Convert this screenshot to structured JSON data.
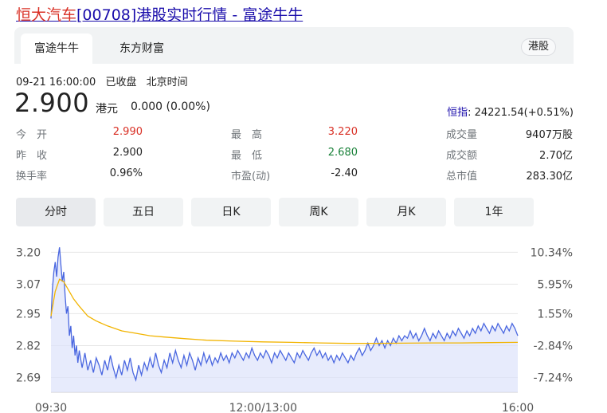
{
  "header": {
    "title_highlight": "恒大汽车",
    "title_rest": "[00708]港股实时行情 - 富途牛牛"
  },
  "source_tabs": [
    {
      "label": "富途牛牛",
      "active": true
    },
    {
      "label": "东方财富",
      "active": false
    }
  ],
  "market_chip": "港股",
  "meta": {
    "datetime": "09-21 16:00:00",
    "status": "已收盘",
    "timezone": "北京时间"
  },
  "quote": {
    "price": "2.900",
    "currency": "港元",
    "change": "0.000 (0.00%)",
    "index_name": "恒指",
    "index_value": ": 24221.54(+0.51%)"
  },
  "stats": [
    [
      {
        "label": "今　开",
        "value": "2.990",
        "tone": "up"
      },
      {
        "label": "最　高",
        "value": "3.220",
        "tone": "up"
      },
      {
        "label": "成交量",
        "value": "9407万股",
        "tone": ""
      }
    ],
    [
      {
        "label": "昨　收",
        "value": "2.900",
        "tone": ""
      },
      {
        "label": "最　低",
        "value": "2.680",
        "tone": "down"
      },
      {
        "label": "成交额",
        "value": "2.70亿",
        "tone": ""
      }
    ],
    [
      {
        "label": "换手率",
        "value": "0.96%",
        "tone": ""
      },
      {
        "label": "市盈(动)",
        "value": "-2.40",
        "tone": ""
      },
      {
        "label": "总市值",
        "value": "283.30亿",
        "tone": ""
      }
    ]
  ],
  "range_tabs": [
    {
      "label": "分时",
      "active": true
    },
    {
      "label": "五日",
      "active": false
    },
    {
      "label": "日K",
      "active": false
    },
    {
      "label": "周K",
      "active": false
    },
    {
      "label": "月K",
      "active": false
    },
    {
      "label": "1年",
      "active": false
    }
  ],
  "colors": {
    "price_line": "#4a67e0",
    "avg_line": "#f2b400",
    "fill": "#dde3fb",
    "grid": "#e6e6e6"
  },
  "chart_data": {
    "type": "line",
    "ylim": [
      2.63,
      3.24
    ],
    "y_ticks": [
      {
        "value": 3.2,
        "label": "3.20",
        "pct": "10.34%"
      },
      {
        "value": 3.07,
        "label": "3.07",
        "pct": "5.95%"
      },
      {
        "value": 2.95,
        "label": "2.95",
        "pct": "1.55%"
      },
      {
        "value": 2.82,
        "label": "2.82",
        "pct": "-2.84%"
      },
      {
        "value": 2.69,
        "label": "2.69",
        "pct": "-7.24%"
      }
    ],
    "x_ticks": [
      {
        "t": 0,
        "label": "09:30"
      },
      {
        "t": 150,
        "label": "12:00/13:00"
      },
      {
        "t": 330,
        "label": "16:00"
      }
    ],
    "t_max": 330,
    "series": [
      {
        "key": "price",
        "values": [
          [
            0,
            2.93
          ],
          [
            1,
            3.05
          ],
          [
            2,
            3.12
          ],
          [
            3,
            3.16
          ],
          [
            4,
            3.1
          ],
          [
            5,
            3.18
          ],
          [
            6,
            3.22
          ],
          [
            7,
            3.15
          ],
          [
            8,
            3.08
          ],
          [
            9,
            3.12
          ],
          [
            10,
            3.02
          ],
          [
            11,
            2.95
          ],
          [
            12,
            2.98
          ],
          [
            13,
            2.86
          ],
          [
            14,
            2.9
          ],
          [
            15,
            2.81
          ],
          [
            16,
            2.86
          ],
          [
            17,
            2.78
          ],
          [
            18,
            2.82
          ],
          [
            19,
            2.75
          ],
          [
            20,
            2.8
          ],
          [
            22,
            2.73
          ],
          [
            24,
            2.79
          ],
          [
            26,
            2.72
          ],
          [
            28,
            2.76
          ],
          [
            30,
            2.71
          ],
          [
            32,
            2.77
          ],
          [
            34,
            2.74
          ],
          [
            36,
            2.7
          ],
          [
            38,
            2.76
          ],
          [
            40,
            2.72
          ],
          [
            42,
            2.78
          ],
          [
            44,
            2.73
          ],
          [
            46,
            2.69
          ],
          [
            48,
            2.74
          ],
          [
            50,
            2.7
          ],
          [
            52,
            2.76
          ],
          [
            54,
            2.72
          ],
          [
            56,
            2.77
          ],
          [
            58,
            2.71
          ],
          [
            60,
            2.68
          ],
          [
            62,
            2.74
          ],
          [
            64,
            2.7
          ],
          [
            66,
            2.75
          ],
          [
            68,
            2.72
          ],
          [
            70,
            2.77
          ],
          [
            72,
            2.73
          ],
          [
            74,
            2.79
          ],
          [
            76,
            2.74
          ],
          [
            78,
            2.71
          ],
          [
            80,
            2.76
          ],
          [
            82,
            2.73
          ],
          [
            84,
            2.79
          ],
          [
            86,
            2.75
          ],
          [
            88,
            2.8
          ],
          [
            90,
            2.76
          ],
          [
            92,
            2.73
          ],
          [
            94,
            2.78
          ],
          [
            96,
            2.74
          ],
          [
            98,
            2.79
          ],
          [
            100,
            2.76
          ],
          [
            102,
            2.72
          ],
          [
            104,
            2.77
          ],
          [
            106,
            2.74
          ],
          [
            108,
            2.79
          ],
          [
            110,
            2.75
          ],
          [
            112,
            2.78
          ],
          [
            114,
            2.74
          ],
          [
            116,
            2.77
          ],
          [
            118,
            2.75
          ],
          [
            120,
            2.79
          ],
          [
            122,
            2.76
          ],
          [
            124,
            2.78
          ],
          [
            126,
            2.75
          ],
          [
            128,
            2.79
          ],
          [
            130,
            2.77
          ],
          [
            132,
            2.8
          ],
          [
            134,
            2.78
          ],
          [
            136,
            2.76
          ],
          [
            138,
            2.79
          ],
          [
            140,
            2.77
          ],
          [
            142,
            2.81
          ],
          [
            144,
            2.78
          ],
          [
            146,
            2.76
          ],
          [
            148,
            2.79
          ],
          [
            150,
            2.77
          ],
          [
            152,
            2.8
          ],
          [
            154,
            2.78
          ],
          [
            156,
            2.75
          ],
          [
            158,
            2.79
          ],
          [
            160,
            2.77
          ],
          [
            162,
            2.8
          ],
          [
            164,
            2.78
          ],
          [
            166,
            2.76
          ],
          [
            168,
            2.79
          ],
          [
            170,
            2.77
          ],
          [
            172,
            2.75
          ],
          [
            174,
            2.79
          ],
          [
            176,
            2.77
          ],
          [
            178,
            2.8
          ],
          [
            180,
            2.78
          ],
          [
            182,
            2.76
          ],
          [
            184,
            2.79
          ],
          [
            186,
            2.81
          ],
          [
            188,
            2.78
          ],
          [
            190,
            2.8
          ],
          [
            192,
            2.77
          ],
          [
            194,
            2.79
          ],
          [
            196,
            2.76
          ],
          [
            198,
            2.78
          ],
          [
            200,
            2.75
          ],
          [
            202,
            2.78
          ],
          [
            204,
            2.76
          ],
          [
            206,
            2.79
          ],
          [
            208,
            2.77
          ],
          [
            210,
            2.75
          ],
          [
            212,
            2.78
          ],
          [
            214,
            2.76
          ],
          [
            216,
            2.79
          ],
          [
            218,
            2.81
          ],
          [
            220,
            2.78
          ],
          [
            222,
            2.8
          ],
          [
            224,
            2.83
          ],
          [
            226,
            2.8
          ],
          [
            228,
            2.82
          ],
          [
            230,
            2.85
          ],
          [
            232,
            2.82
          ],
          [
            234,
            2.84
          ],
          [
            236,
            2.81
          ],
          [
            238,
            2.84
          ],
          [
            240,
            2.82
          ],
          [
            242,
            2.85
          ],
          [
            244,
            2.83
          ],
          [
            246,
            2.86
          ],
          [
            248,
            2.84
          ],
          [
            250,
            2.86
          ],
          [
            252,
            2.85
          ],
          [
            254,
            2.88
          ],
          [
            256,
            2.85
          ],
          [
            258,
            2.87
          ],
          [
            260,
            2.84
          ],
          [
            262,
            2.86
          ],
          [
            264,
            2.89
          ],
          [
            266,
            2.86
          ],
          [
            268,
            2.84
          ],
          [
            270,
            2.87
          ],
          [
            272,
            2.85
          ],
          [
            274,
            2.88
          ],
          [
            276,
            2.86
          ],
          [
            278,
            2.84
          ],
          [
            280,
            2.87
          ],
          [
            282,
            2.85
          ],
          [
            284,
            2.88
          ],
          [
            286,
            2.86
          ],
          [
            288,
            2.89
          ],
          [
            290,
            2.87
          ],
          [
            292,
            2.85
          ],
          [
            294,
            2.88
          ],
          [
            296,
            2.86
          ],
          [
            298,
            2.89
          ],
          [
            300,
            2.87
          ],
          [
            302,
            2.9
          ],
          [
            304,
            2.88
          ],
          [
            306,
            2.91
          ],
          [
            308,
            2.89
          ],
          [
            310,
            2.87
          ],
          [
            312,
            2.9
          ],
          [
            314,
            2.88
          ],
          [
            316,
            2.91
          ],
          [
            318,
            2.89
          ],
          [
            320,
            2.87
          ],
          [
            322,
            2.9
          ],
          [
            324,
            2.88
          ],
          [
            326,
            2.91
          ],
          [
            328,
            2.89
          ],
          [
            330,
            2.86
          ]
        ]
      },
      {
        "key": "average",
        "values": [
          [
            0,
            2.94
          ],
          [
            3,
            3.04
          ],
          [
            6,
            3.09
          ],
          [
            9,
            3.08
          ],
          [
            12,
            3.05
          ],
          [
            16,
            3.01
          ],
          [
            20,
            2.98
          ],
          [
            26,
            2.94
          ],
          [
            32,
            2.92
          ],
          [
            40,
            2.9
          ],
          [
            50,
            2.88
          ],
          [
            60,
            2.87
          ],
          [
            70,
            2.86
          ],
          [
            80,
            2.855
          ],
          [
            95,
            2.848
          ],
          [
            110,
            2.842
          ],
          [
            130,
            2.838
          ],
          [
            150,
            2.835
          ],
          [
            170,
            2.833
          ],
          [
            190,
            2.831
          ],
          [
            210,
            2.829
          ],
          [
            230,
            2.829
          ],
          [
            250,
            2.83
          ],
          [
            270,
            2.831
          ],
          [
            290,
            2.831
          ],
          [
            310,
            2.832
          ],
          [
            330,
            2.833
          ]
        ]
      }
    ]
  }
}
